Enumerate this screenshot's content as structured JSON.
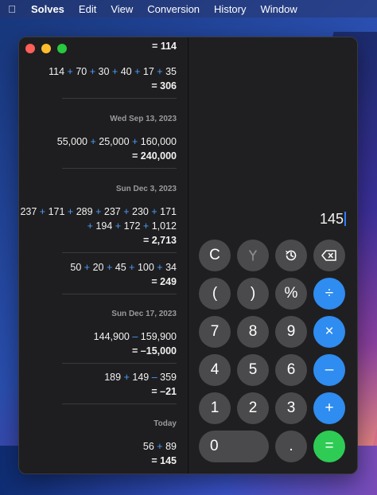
{
  "menubar": {
    "apple_icon": "apple-logo",
    "app": "Solves",
    "items": [
      "Edit",
      "View",
      "Conversion",
      "History",
      "Window"
    ]
  },
  "history": {
    "entries": [
      {
        "lines": [],
        "result": "= 114"
      },
      {
        "lines": [
          "114 + 70 + 30 + 40 + 17 + 35"
        ],
        "result": "= 306"
      },
      {
        "date": "Wed Sep 13, 2023",
        "lines": [
          "55,000 + 25,000 + 160,000"
        ],
        "result": "= 240,000"
      },
      {
        "date": "Sun Dec 3, 2023",
        "lines": [
          "237 + 171 + 289 + 237 + 230 + 171",
          "+ 194 + 172 + 1,012"
        ],
        "result": "= 2,713"
      },
      {
        "lines": [
          "50 + 20 + 45 + 100 + 34"
        ],
        "result": "= 249"
      },
      {
        "date": "Sun Dec 17, 2023",
        "lines": [
          "144,900 – 159,900"
        ],
        "result": "= –15,000"
      },
      {
        "lines": [
          "189 + 149 – 359"
        ],
        "result": "= –21"
      },
      {
        "date": "Today",
        "lines": [
          "56 + 89"
        ],
        "result": "= 145"
      }
    ]
  },
  "calculator": {
    "display": "145",
    "buttons": {
      "clear": "C",
      "branch_icon": "branch-icon",
      "history_icon": "history-icon",
      "backspace_icon": "backspace-icon",
      "open_paren": "(",
      "close_paren": ")",
      "percent": "%",
      "divide": "÷",
      "seven": "7",
      "eight": "8",
      "nine": "9",
      "multiply": "×",
      "four": "4",
      "five": "5",
      "six": "6",
      "minus": "–",
      "one": "1",
      "two": "2",
      "three": "3",
      "plus": "+",
      "zero": "0",
      "decimal": ".",
      "equals": "="
    }
  },
  "colors": {
    "accent_blue": "#2f8cf0",
    "equals_green": "#2ecc55",
    "button_dark": "#4a4a4c",
    "operator_text_blue": "#4a9cf5"
  }
}
